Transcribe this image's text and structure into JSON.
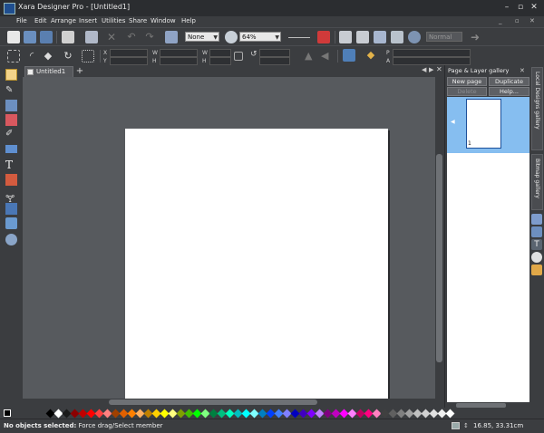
{
  "window": {
    "title": "Xara Designer Pro - [Untitled1]"
  },
  "menu": [
    "File",
    "Edit",
    "Arrange",
    "Insert",
    "Utilities",
    "Share",
    "Window",
    "Help"
  ],
  "toolbar": {
    "quality_value": "None",
    "zoom_value": "64%",
    "style_placeholder": "Normal",
    "x_label": "X",
    "y_label": "Y",
    "w_label": "W",
    "h_label": "H",
    "p_label": "P",
    "a_label": "A"
  },
  "document": {
    "tab_label": "Untitled1"
  },
  "gallery": {
    "title": "Page & Layer gallery",
    "new_page": "New page",
    "duplicate": "Duplicate",
    "delete": "Delete",
    "help": "Help...",
    "page_number": "1"
  },
  "side_tabs": [
    "Local Designs gallery",
    "Bitmap gallery"
  ],
  "palette_colors": [
    "#000000",
    "#ffffff",
    "#1a1a1a",
    "#8b0000",
    "#c00000",
    "#ff0000",
    "#ff4040",
    "#ff8080",
    "#a04000",
    "#e06000",
    "#ff8000",
    "#ffb060",
    "#c08000",
    "#ffd000",
    "#ffff00",
    "#ffff80",
    "#80a000",
    "#40c000",
    "#00ff00",
    "#80ff80",
    "#008040",
    "#00c080",
    "#00ffc0",
    "#00c0c0",
    "#00ffff",
    "#80ffff",
    "#0080c0",
    "#0040ff",
    "#4080ff",
    "#8080ff",
    "#0000c0",
    "#4000c0",
    "#8000ff",
    "#c080ff",
    "#800080",
    "#c000c0",
    "#ff00ff",
    "#ff80ff",
    "#c00060",
    "#ff0080",
    "#ff80c0",
    "#404040",
    "#606060",
    "#808080",
    "#a0a0a0",
    "#c0c0c0",
    "#d0d0d0",
    "#e0e0e0",
    "#f0f0f0",
    "#ffffff"
  ],
  "status": {
    "message": "No objects selected:",
    "hint": "Force drag/Select member",
    "coords": "16.85, 33.31cm"
  }
}
